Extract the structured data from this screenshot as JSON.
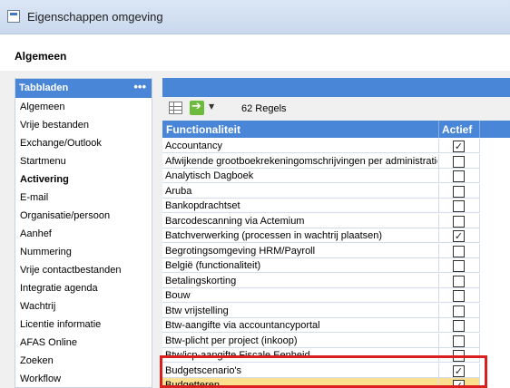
{
  "window": {
    "title": "Eigenschappen omgeving"
  },
  "header": {
    "section_title": "Algemeen"
  },
  "sidebar": {
    "title": "Tabbladen",
    "more_label": "•••",
    "items": [
      {
        "label": "Algemeen",
        "active": false
      },
      {
        "label": "Vrije bestanden",
        "active": false
      },
      {
        "label": "Exchange/Outlook",
        "active": false
      },
      {
        "label": "Startmenu",
        "active": false
      },
      {
        "label": "Activering",
        "active": true
      },
      {
        "label": "E-mail",
        "active": false
      },
      {
        "label": "Organisatie/persoon",
        "active": false
      },
      {
        "label": "Aanhef",
        "active": false
      },
      {
        "label": "Nummering",
        "active": false
      },
      {
        "label": "Vrije contactbestanden",
        "active": false
      },
      {
        "label": "Integratie agenda",
        "active": false
      },
      {
        "label": "Wachtrij",
        "active": false
      },
      {
        "label": "Licentie informatie",
        "active": false
      },
      {
        "label": "AFAS Online",
        "active": false
      },
      {
        "label": "Zoeken",
        "active": false
      },
      {
        "label": "Workflow",
        "active": false
      }
    ]
  },
  "toolbar": {
    "grid_icon": "grid-icon",
    "arrow_icon": "arrow-right-icon",
    "dropdown_glyph": "▼",
    "record_count": "62 Regels"
  },
  "grid": {
    "columns": {
      "functionaliteit": "Functionaliteit",
      "actief": "Actief"
    },
    "rows": [
      {
        "name": "Accountancy",
        "active": true
      },
      {
        "name": "Afwijkende grootboekrekeningomschrijvingen per administratie",
        "active": false
      },
      {
        "name": "Analytisch Dagboek",
        "active": false
      },
      {
        "name": "Aruba",
        "active": false
      },
      {
        "name": "Bankopdrachtset",
        "active": false
      },
      {
        "name": "Barcodescanning via Actemium",
        "active": false
      },
      {
        "name": "Batchverwerking (processen in wachtrij plaatsen)",
        "active": true
      },
      {
        "name": "Begrotingsomgeving HRM/Payroll",
        "active": false
      },
      {
        "name": "België (functionaliteit)",
        "active": false
      },
      {
        "name": "Betalingskorting",
        "active": false
      },
      {
        "name": "Bouw",
        "active": false
      },
      {
        "name": "Btw vrijstelling",
        "active": false
      },
      {
        "name": "Btw-aangifte via accountancyportal",
        "active": false
      },
      {
        "name": "Btw-plicht per project (inkoop)",
        "active": false
      },
      {
        "name": "Btw/icp-aangifte Fiscale Eenheid",
        "active": false
      },
      {
        "name": "Budgetscenario's",
        "active": true
      },
      {
        "name": "Budgetteren",
        "active": true,
        "selected": true
      }
    ]
  },
  "colors": {
    "accent": "#4a86d8",
    "selected_row": "#fbe08f",
    "highlight_border": "#d9201e"
  }
}
